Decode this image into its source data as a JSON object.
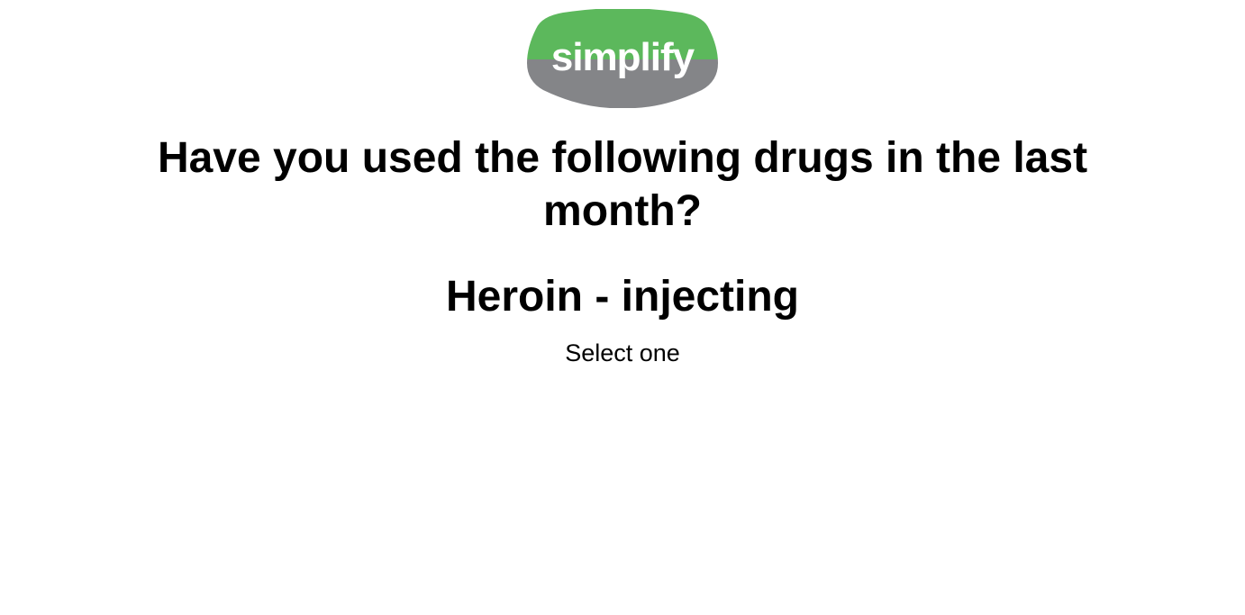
{
  "brand": {
    "name": "simplify",
    "colors": {
      "top": "#5cb85c",
      "bottom": "#848588",
      "text": "#ffffff"
    }
  },
  "question": {
    "line1": "Have you used the following drugs in the last",
    "line2": "month?"
  },
  "drug": {
    "name": "Heroin - injecting"
  },
  "instruction": "Select one"
}
